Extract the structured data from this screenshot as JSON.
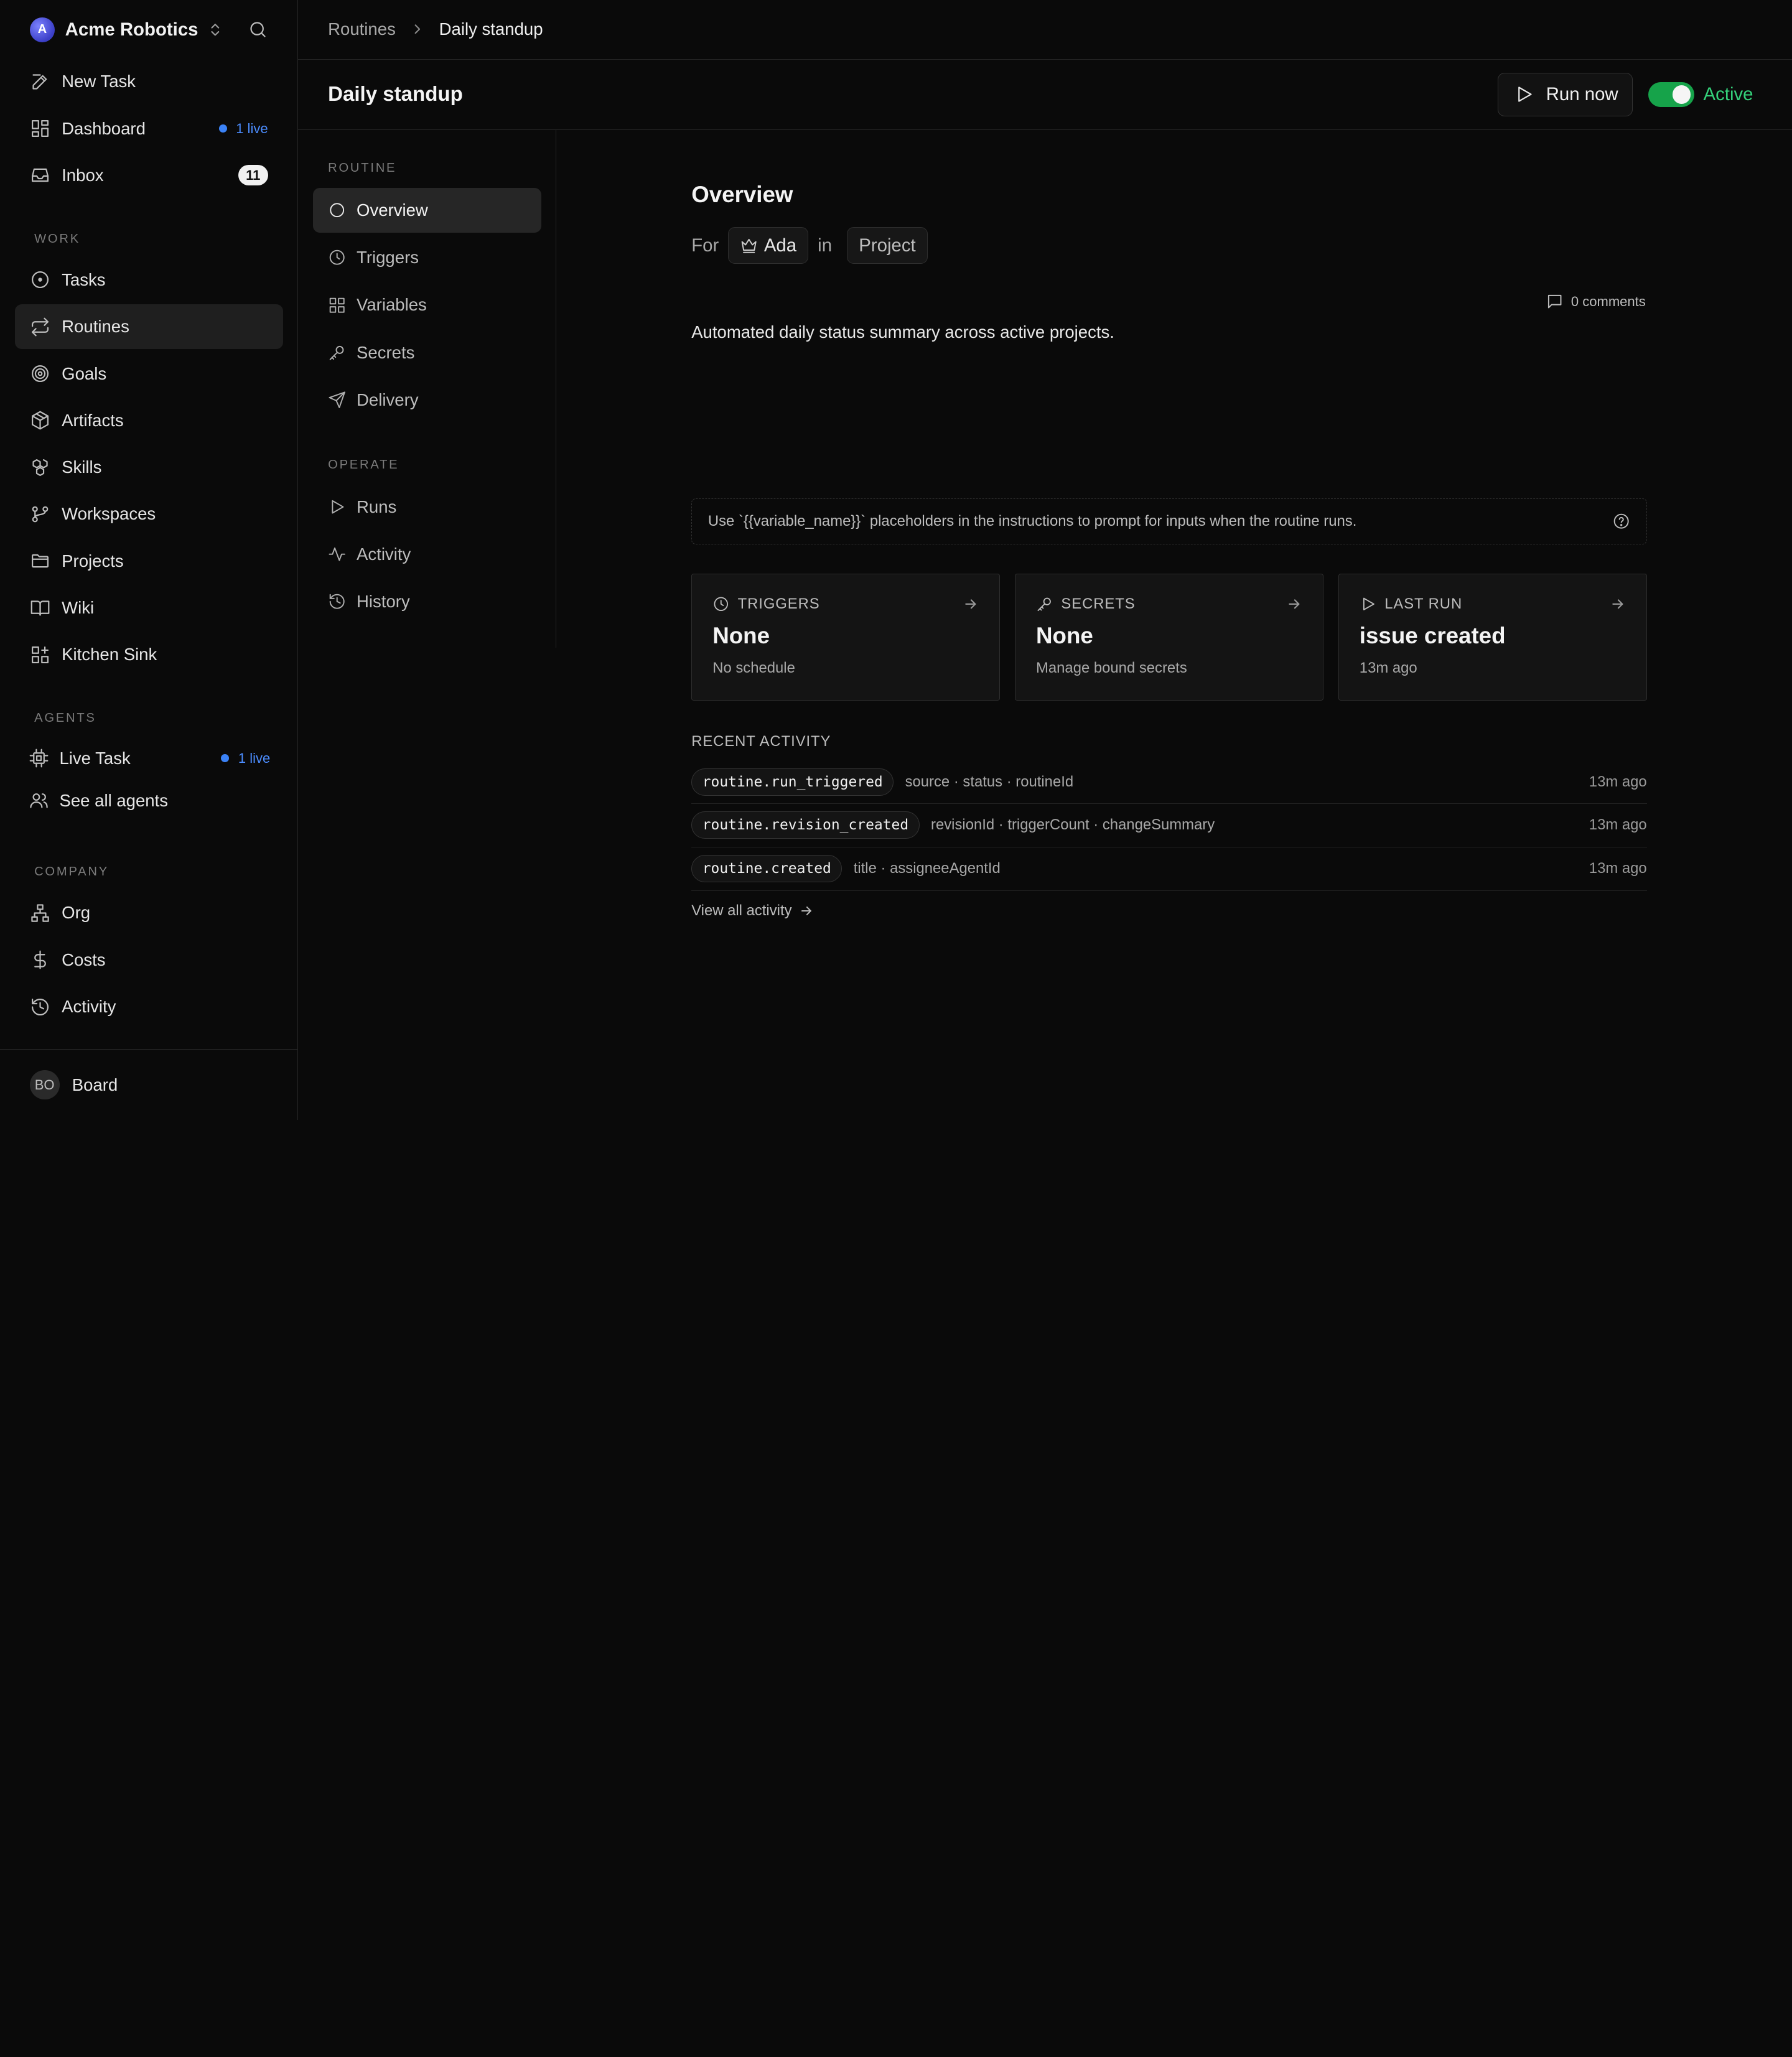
{
  "brand": {
    "logo_letter": "A",
    "name": "Acme Robotics"
  },
  "sidebar": {
    "main": [
      {
        "label": "New Task",
        "icon": "edit-icon"
      },
      {
        "label": "Dashboard",
        "icon": "dashboard-icon",
        "live": "1 live"
      },
      {
        "label": "Inbox",
        "icon": "inbox-icon",
        "count": "11"
      }
    ],
    "work_label": "WORK",
    "work": [
      {
        "label": "Tasks",
        "icon": "circle-dot-icon"
      },
      {
        "label": "Routines",
        "icon": "repeat-icon",
        "active": true
      },
      {
        "label": "Goals",
        "icon": "target-icon"
      },
      {
        "label": "Artifacts",
        "icon": "package-icon"
      },
      {
        "label": "Skills",
        "icon": "boxes-icon"
      },
      {
        "label": "Workspaces",
        "icon": "git-branch-icon"
      },
      {
        "label": "Projects",
        "icon": "folder-icon"
      },
      {
        "label": "Wiki",
        "icon": "book-icon"
      },
      {
        "label": "Kitchen Sink",
        "icon": "grid-plus-icon"
      }
    ],
    "agents_label": "AGENTS",
    "agents": [
      {
        "label": "Live Task",
        "icon": "cpu-icon",
        "live": "1 live"
      },
      {
        "label": "See all agents",
        "icon": "users-icon"
      }
    ],
    "company_label": "COMPANY",
    "company": [
      {
        "label": "Org",
        "icon": "org-icon"
      },
      {
        "label": "Costs",
        "icon": "dollar-icon"
      },
      {
        "label": "Activity",
        "icon": "history-icon"
      }
    ],
    "footer": {
      "initials": "BO",
      "label": "Board"
    }
  },
  "breadcrumb": {
    "root": "Routines",
    "current": "Daily standup"
  },
  "header": {
    "title": "Daily standup",
    "run_label": "Run now",
    "status_label": "Active",
    "accent": "#16a34a"
  },
  "subnav": {
    "routine_label": "ROUTINE",
    "routine": [
      {
        "label": "Overview",
        "icon": "circle-icon",
        "active": true
      },
      {
        "label": "Triggers",
        "icon": "clock-icon"
      },
      {
        "label": "Variables",
        "icon": "dashboard-icon"
      },
      {
        "label": "Secrets",
        "icon": "key-icon"
      },
      {
        "label": "Delivery",
        "icon": "send-icon"
      }
    ],
    "operate_label": "OPERATE",
    "operate": [
      {
        "label": "Runs",
        "icon": "play-icon"
      },
      {
        "label": "Activity",
        "icon": "pulse-icon"
      },
      {
        "label": "History",
        "icon": "history-icon"
      }
    ]
  },
  "overview": {
    "title": "Overview",
    "for_label": "For",
    "assignee": "Ada",
    "in_label": "in",
    "project": "Project",
    "comments": "0 comments",
    "description": "Automated daily status summary across active projects.",
    "hint": "Use `{{variable_name}}` placeholders in the instructions to prompt for inputs when the routine runs."
  },
  "cards": [
    {
      "label": "TRIGGERS",
      "icon": "clock-icon",
      "value": "None",
      "sub": "No schedule"
    },
    {
      "label": "SECRETS",
      "icon": "key-icon",
      "value": "None",
      "sub": "Manage bound secrets"
    },
    {
      "label": "LAST RUN",
      "icon": "play-icon",
      "value": "issue created",
      "sub": "13m ago"
    }
  ],
  "recent_activity": {
    "title": "RECENT ACTIVITY",
    "rows": [
      {
        "event": "routine.run_triggered",
        "meta": "source · status · routineId",
        "time": "13m ago"
      },
      {
        "event": "routine.revision_created",
        "meta": "revisionId · triggerCount · changeSummary",
        "time": "13m ago"
      },
      {
        "event": "routine.created",
        "meta": "title · assigneeAgentId",
        "time": "13m ago"
      }
    ],
    "view_all": "View all activity"
  }
}
